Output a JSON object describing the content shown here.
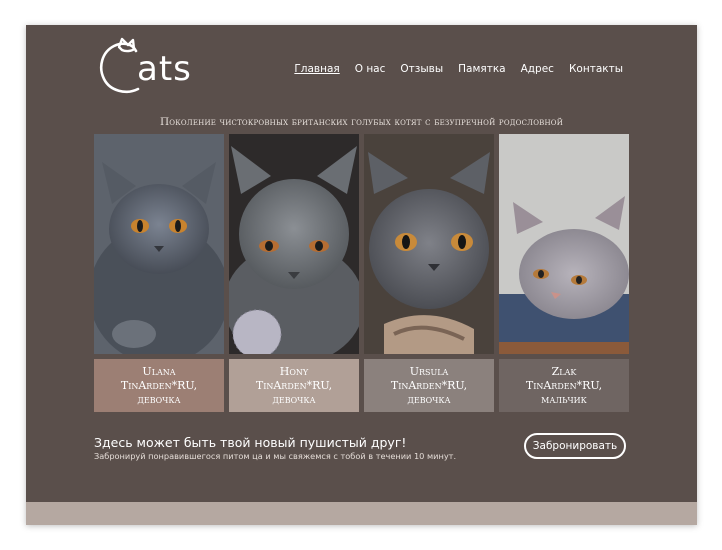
{
  "logo": {
    "text": "ats"
  },
  "nav": {
    "items": [
      {
        "label": "Главная",
        "active": true
      },
      {
        "label": "О нас"
      },
      {
        "label": "Отзывы"
      },
      {
        "label": "Памятка"
      },
      {
        "label": "Адрес"
      },
      {
        "label": "Контакты"
      }
    ]
  },
  "tagline": "Поколение чистокровных британских голубых котят с безупречной родословной",
  "cats": [
    {
      "line1": "Ulana",
      "line2": "TinArden*RU,",
      "line3": "девочка",
      "color": "#9c7f74"
    },
    {
      "line1": "Hony",
      "line2": "TinArden*RU,",
      "line3": "девочка",
      "color": "#b1a097"
    },
    {
      "line1": "Ursula",
      "line2": "TinArden*RU,",
      "line3": "девочка",
      "color": "#8b817d"
    },
    {
      "line1": "Zlak",
      "line2": "TinArden*RU,",
      "line3": "мальчик",
      "color": "#6f6562"
    }
  ],
  "cta": {
    "title": "Здесь может быть твой новый пушистый друг!",
    "subtitle": "Забронируй понравившегося питом ца и мы свяжемся с тобой в течении 10 минут.",
    "button": "Забронировать"
  },
  "colors": {
    "background": "#5a4f4b",
    "footer": "#b5a8a1"
  }
}
